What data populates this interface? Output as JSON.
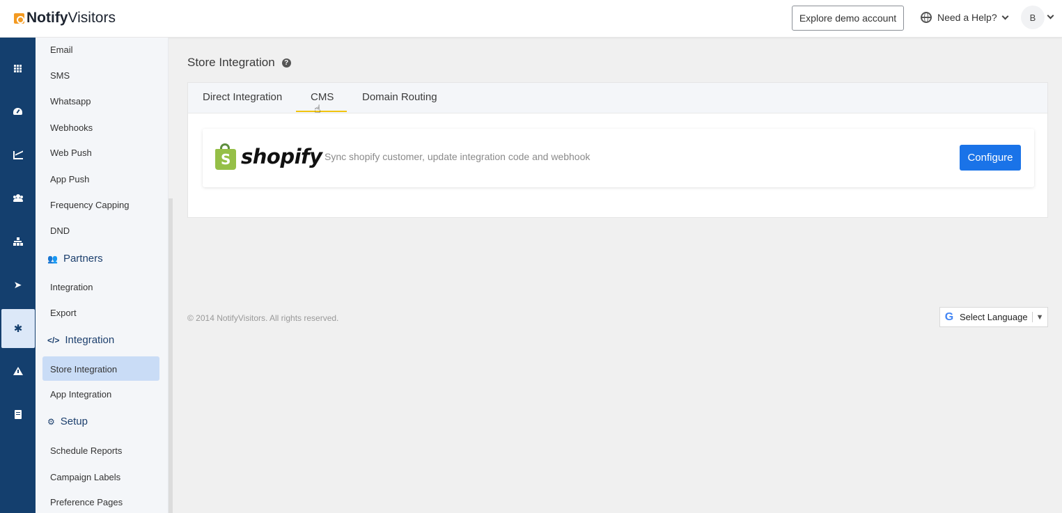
{
  "header": {
    "brand_bold": "Notify",
    "brand_light": "Visitors",
    "demo_button": "Explore demo account",
    "help": "Need a Help?",
    "avatar_initial": "B"
  },
  "rail": {
    "items": [
      "grid-icon",
      "dashboard-gauge-icon",
      "analytics-chart-icon",
      "users-icon",
      "hierarchy-icon",
      "paper-plane-icon",
      "gear-icon",
      "warning-icon",
      "document-icon"
    ],
    "active": "gear-icon",
    "gear_glyph": "✱"
  },
  "sidebar": {
    "links": {
      "email": "Email",
      "sms": "SMS",
      "whatsapp": "Whatsapp",
      "webhooks": "Webhooks",
      "web_push": "Web Push",
      "app_push": "App Push",
      "frequency_capping": "Frequency Capping",
      "dnd": "DND",
      "partners_integration": "Integration",
      "export": "Export",
      "store_integration": "Store Integration",
      "app_integration": "App Integration",
      "schedule_reports": "Schedule Reports",
      "campaign_labels": "Campaign Labels",
      "preference_pages": "Preference Pages"
    },
    "headings": {
      "partners": "Partners",
      "integration": "Integration",
      "setup": "Setup"
    },
    "active_item": "Store Integration"
  },
  "content": {
    "title": "Store Integration",
    "help_glyph": "?",
    "tabs": [
      "Direct Integration",
      "CMS",
      "Domain Routing"
    ],
    "active_tab": "CMS",
    "card": {
      "logo_text": "shopify",
      "logo_glyph": "S",
      "description": "Sync shopify customer, update integration code and webhook",
      "button": "Configure"
    }
  },
  "footer": {
    "copyright": "© 2014 NotifyVisitors. All rights reserved.",
    "language": "Select Language",
    "google_glyph": "G"
  },
  "colors": {
    "rail_bg": "#143f6e",
    "accent_blue": "#1a73e8",
    "tab_underline": "#f1c40f",
    "shopify_green": "#95bf47",
    "brand_orange": "#f39a21"
  }
}
